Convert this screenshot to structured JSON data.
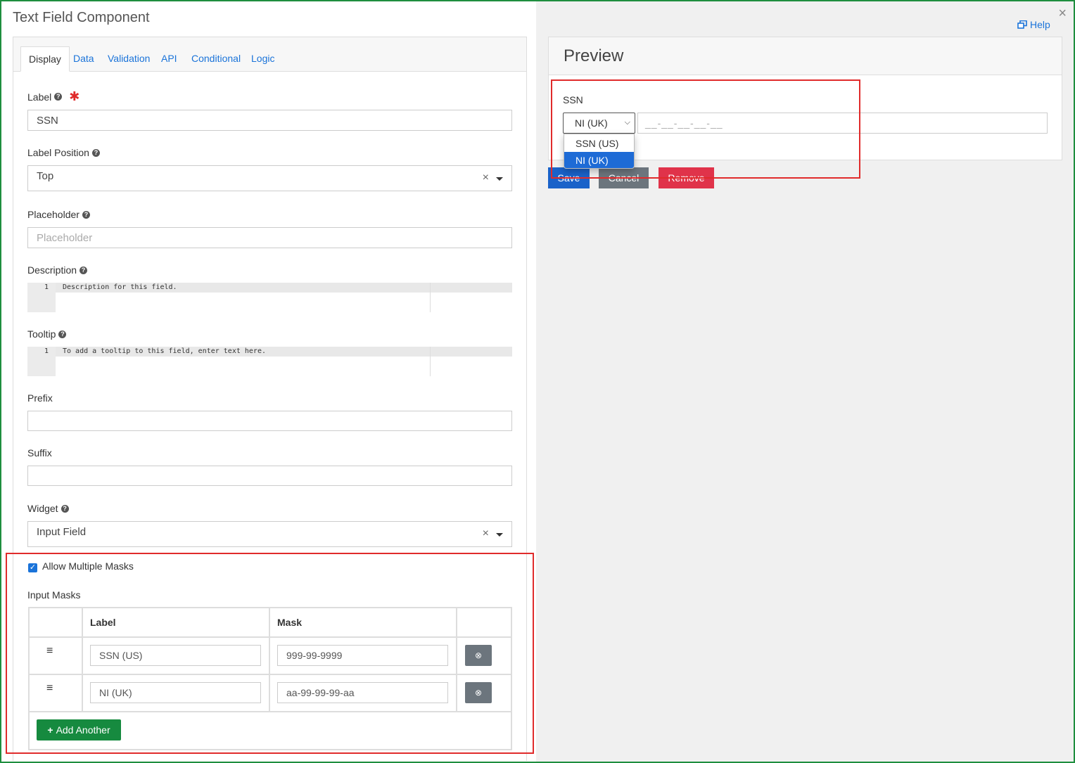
{
  "modal": {
    "title": "Text Field Component",
    "help": "Help",
    "close": "×"
  },
  "tabs": [
    "Display",
    "Data",
    "Validation",
    "API",
    "Conditional",
    "Logic"
  ],
  "fields": {
    "label": {
      "label": "Label",
      "value": "SSN",
      "required_mark": "✱"
    },
    "label_position": {
      "label": "Label Position",
      "value": "Top"
    },
    "placeholder": {
      "label": "Placeholder",
      "placeholder": "Placeholder"
    },
    "description": {
      "label": "Description",
      "line": "1",
      "text": "Description for this field."
    },
    "tooltip": {
      "label": "Tooltip",
      "line": "1",
      "text": "To add a tooltip to this field, enter text here."
    },
    "prefix": {
      "label": "Prefix",
      "value": ""
    },
    "suffix": {
      "label": "Suffix",
      "value": ""
    },
    "widget": {
      "label": "Widget",
      "value": "Input Field"
    }
  },
  "masks": {
    "allow_multiple": {
      "label": "Allow Multiple Masks",
      "checked": true
    },
    "input_masks_label": "Input Masks",
    "headers": {
      "label": "Label",
      "mask": "Mask"
    },
    "rows": [
      {
        "label": "SSN (US)",
        "mask": "999-99-9999"
      },
      {
        "label": "NI (UK)",
        "mask": "aa-99-99-99-aa"
      }
    ],
    "add_button": "Add Another"
  },
  "preview": {
    "title": "Preview",
    "field_label": "SSN",
    "selected_mask": "NI (UK)",
    "mask_placeholder": "__-__-__-__-__",
    "options": [
      "SSN (US)",
      "NI (UK)"
    ],
    "highlighted_option": "NI (UK)"
  },
  "buttons": {
    "save": "Save",
    "cancel": "Cancel",
    "remove": "Remove"
  },
  "colors": {
    "primary": "#1a73d9",
    "success": "#168a3f",
    "danger": "#e02b2b",
    "secondary": "#6c757d",
    "frame": "#1e8e3e"
  }
}
